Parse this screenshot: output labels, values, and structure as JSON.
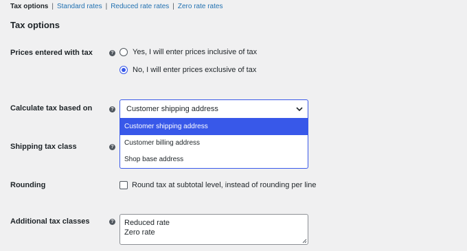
{
  "subnav": {
    "current": "Tax options",
    "links": [
      "Standard rates",
      "Reduced rate rates",
      "Zero rate rates"
    ]
  },
  "section_title": "Tax options",
  "prices_entered": {
    "label": "Prices entered with tax",
    "help_icon": "?",
    "options": [
      {
        "label": "Yes, I will enter prices inclusive of tax",
        "checked": false
      },
      {
        "label": "No, I will enter prices exclusive of tax",
        "checked": true
      }
    ]
  },
  "calculate_tax": {
    "label": "Calculate tax based on",
    "help_icon": "?",
    "selected": "Customer shipping address",
    "options": [
      "Customer shipping address",
      "Customer billing address",
      "Shop base address"
    ]
  },
  "shipping_tax_class": {
    "label": "Shipping tax class",
    "help_icon": "?"
  },
  "rounding": {
    "label": "Rounding",
    "checkbox_label": "Round tax at subtotal level, instead of rounding per line",
    "checked": false
  },
  "additional_tax_classes": {
    "label": "Additional tax classes",
    "help_icon": "?",
    "lines": [
      "Reduced rate",
      "Zero rate"
    ]
  },
  "colors": {
    "accent": "#3858e9",
    "link": "#2271b1",
    "background": "#f0f0f1"
  }
}
